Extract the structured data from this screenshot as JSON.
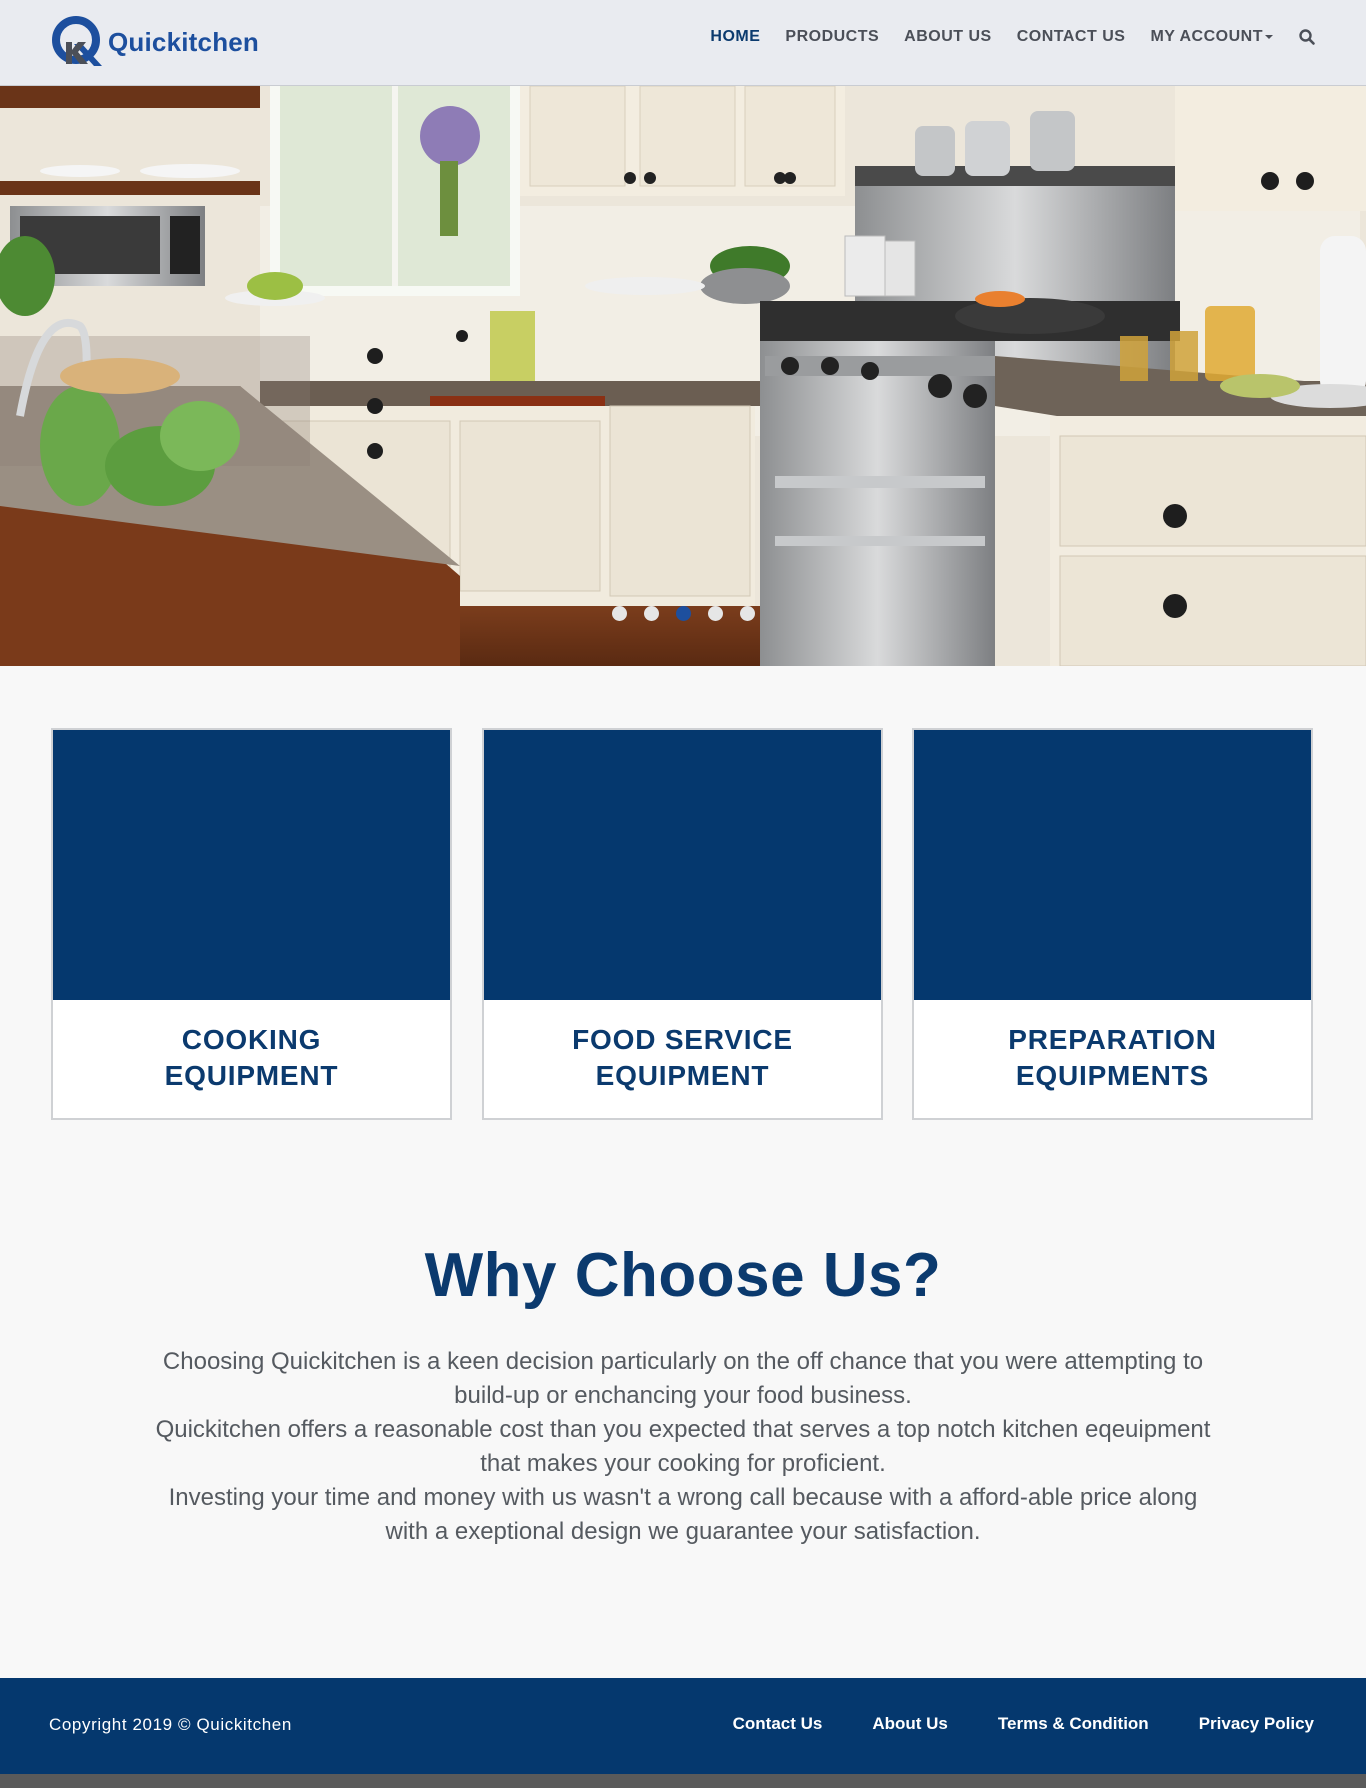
{
  "brand": {
    "name": "Quickitchen",
    "accent_color": "#1d4f9e",
    "logo_icon": "q-logo-icon"
  },
  "nav": {
    "items": [
      {
        "label": "HOME",
        "active": true
      },
      {
        "label": "PRODUCTS",
        "active": false
      },
      {
        "label": "ABOUT US",
        "active": false
      },
      {
        "label": "CONTACT US",
        "active": false
      },
      {
        "label": "MY ACCOUNT",
        "active": false,
        "dropdown": true
      }
    ],
    "search_icon": "search-icon"
  },
  "hero": {
    "slide_count": 5,
    "active_slide": 3
  },
  "categories": [
    {
      "title_line1": "COOKING",
      "title_line2": "EQUIPMENT"
    },
    {
      "title_line1": "FOOD SERVICE",
      "title_line2": "EQUIPMENT"
    },
    {
      "title_line1": "PREPARATION",
      "title_line2": "EQUIPMENTS"
    }
  ],
  "why": {
    "title": "Why Choose Us?",
    "lines": [
      "Choosing Quickitchen is a keen decision particularly on the off chance that you were attempting to build-up or enchancing your food business.",
      "Quickitchen offers a reasonable cost than you expected that serves a top notch kitchen eqeuipment that makes your cooking for proficient.",
      "Investing your time and money with us wasn't a wrong call because with a afford-able price along with a exeptional design we guarantee your satisfaction."
    ]
  },
  "footer": {
    "copyright": "Copyright 2019 © Quickitchen",
    "links": [
      "Contact Us",
      "About Us",
      "Terms & Condition",
      "Privacy Policy"
    ]
  },
  "colors": {
    "navy": "#05386e",
    "heading": "#0b3a6e",
    "nav_bg": "#e9ebf0"
  }
}
